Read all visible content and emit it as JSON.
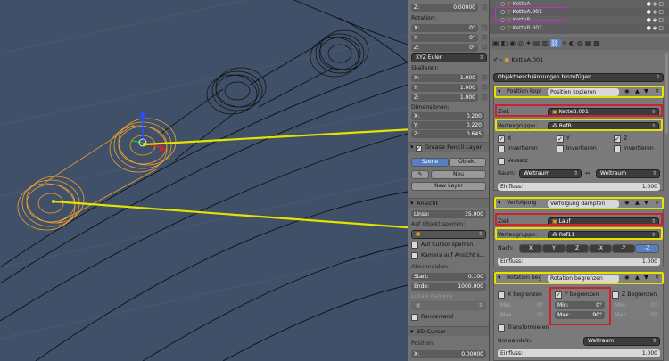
{
  "outliner": {
    "items": [
      "KetteA",
      "KetteA.001",
      "KetteB",
      "KetteB.001"
    ]
  },
  "n_panel": {
    "z_top": {
      "label": "Z:",
      "value": "0.00000"
    },
    "rotation": {
      "title": "Rotation:",
      "x": {
        "label": "X:",
        "value": "0°"
      },
      "y": {
        "label": "Y:",
        "value": "0°"
      },
      "z": {
        "label": "Z:",
        "value": "0°"
      },
      "mode": "XYZ Euler"
    },
    "scale": {
      "title": "Skalieren:",
      "x": {
        "label": "X:",
        "value": "1.000"
      },
      "y": {
        "label": "Y:",
        "value": "1.000"
      },
      "z": {
        "label": "Z:",
        "value": "1.000"
      }
    },
    "dimensions": {
      "title": "Dimensionen:",
      "x": {
        "label": "X:",
        "value": "0.200"
      },
      "y": {
        "label": "Y:",
        "value": "0.220"
      },
      "z": {
        "label": "Z:",
        "value": "0.645"
      }
    },
    "grease_pencil": {
      "title": "Grease Pencil Layer",
      "tab_scene": "Szene",
      "tab_object": "Objekt",
      "new_btn": "Neu",
      "new_layer_btn": "New Layer"
    },
    "view": {
      "title": "Ansicht",
      "lens": {
        "label": "Linse:",
        "value": "35.000"
      },
      "lock_to_object": "Auf Objekt sperren:",
      "lock_cursor": "Auf Cursor sperren",
      "lock_camera": "Kamera auf Ansicht s...",
      "clip": "Abschneiden:",
      "clip_start": {
        "label": "Start:",
        "value": "0.100"
      },
      "clip_end": {
        "label": "Ende:",
        "value": "1000.000"
      },
      "local_camera": "Lokale Kamera:",
      "render_only": "Renderrand"
    },
    "cursor": {
      "title": "3D-Cursor",
      "location": "Position:",
      "x": {
        "label": "X:",
        "value": "0.00000"
      }
    }
  },
  "properties": {
    "breadcrumb_object": "KetteA.001",
    "add_constraint": "Objektbeschränkungen hinzufügen",
    "c1": {
      "type": "Position kopi",
      "name": "Position kopieren",
      "target_label": "Ziel:",
      "target": "KetteB.001",
      "vgroup_label": "Vertexgruppe:",
      "vgroup": "RefB",
      "axis_x": "X",
      "axis_y": "Y",
      "axis_z": "Z",
      "invert": "Invertieren",
      "offset": "Versatz",
      "space_label": "Raum:",
      "space_a": "Weltraum",
      "space_b": "Weltraum",
      "influence_label": "Einfluss:",
      "influence": "1.000"
    },
    "c2": {
      "type": "Verfolgung",
      "name": "Verfolgung dämpfen",
      "target_label": "Ziel:",
      "target": "Lauf",
      "vgroup_label": "Vertexgruppe:",
      "vgroup": "Ref11",
      "to_label": "Nach:",
      "axes": [
        "X",
        "Y",
        "Z",
        "-X",
        "-Y",
        "-Z"
      ],
      "influence_label": "Einfluss:",
      "influence": "1.000"
    },
    "c3": {
      "type": "Rotation beg",
      "name": "Rotation begrenzen",
      "limit_x": "X begrenzen",
      "limit_y": "Y begrenzen",
      "limit_z": "Z Begrenzen",
      "min_label": "Min:",
      "max_label": "Max:",
      "x_min": "0°",
      "x_max": "0°",
      "y_min": "0°",
      "y_max": "90°",
      "z_min": "0°",
      "z_max": "0°",
      "transform": "Transformieren",
      "convert_label": "Umwandeln:",
      "convert": "Weltraum",
      "influence_label": "Einfluss:",
      "influence": "1.000"
    }
  },
  "colors": {
    "highlight_yellow": "#e4e200",
    "highlight_red": "#d02030",
    "selection_orange": "#f0a030",
    "viewport_bg": "#3f5068"
  }
}
